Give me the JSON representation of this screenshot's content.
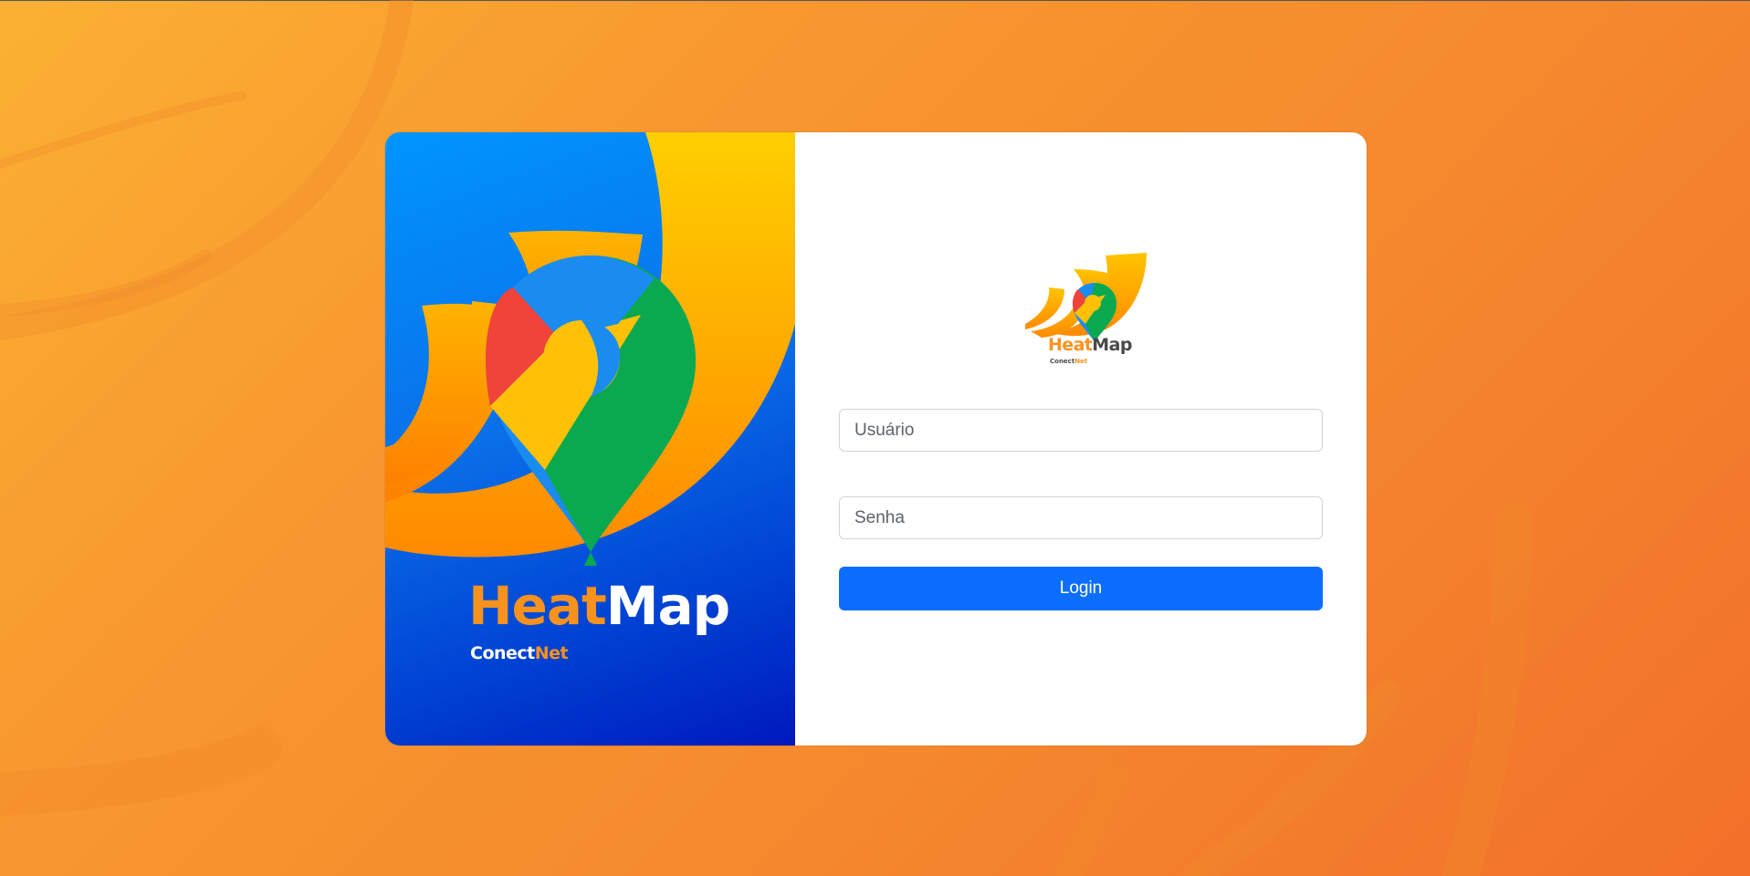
{
  "app": {
    "brand_heat": "Heat",
    "brand_map": "Map",
    "brand_conect": "Conect",
    "brand_net": "Net"
  },
  "login_form": {
    "username_placeholder": "Usuário",
    "username_value": "",
    "password_placeholder": "Senha",
    "password_value": "",
    "login_label": "Login"
  },
  "colors": {
    "background_orange": "#f58a2e",
    "hero_blue": "#0a6fe8",
    "brand_orange": "#f7921e",
    "button_blue": "#0d6efd",
    "pin_red": "#f0433a",
    "pin_green": "#0aa84f",
    "pin_yellow": "#ffc107",
    "pin_blue": "#1a8cf0"
  },
  "icons": {
    "hero_art": "map-pin-logo-icon",
    "small_logo": "heatmap-logo-icon"
  }
}
